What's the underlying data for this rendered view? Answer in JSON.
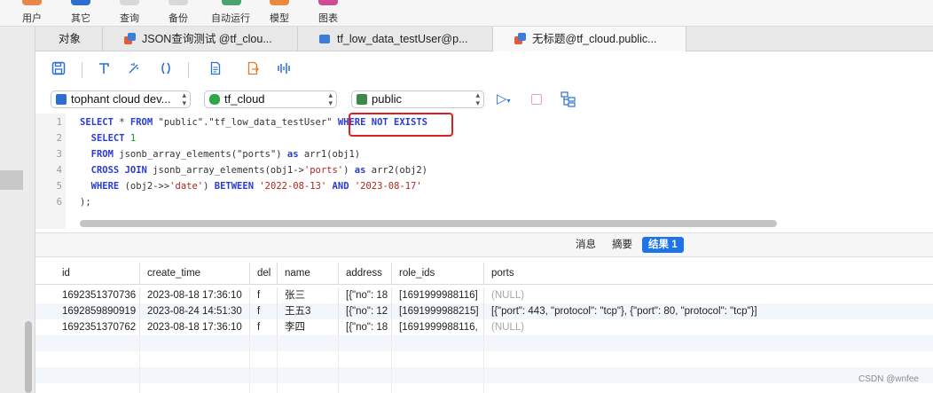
{
  "toolbar": {
    "items": [
      {
        "label": "用户",
        "color": "#e9874a"
      },
      {
        "label": "其它",
        "color": "#2d6fd0"
      },
      {
        "label": "查询",
        "color": "#d8d8d8"
      },
      {
        "label": "备份",
        "color": "#d8d8d8"
      },
      {
        "label": "自动运行",
        "color": "#4aa36a"
      },
      {
        "label": "模型",
        "color": "#e98a3d"
      },
      {
        "label": "图表",
        "color": "#cc4e92"
      }
    ]
  },
  "tabs": [
    {
      "label": "对象",
      "icon": ""
    },
    {
      "label": "JSON查询测试 @tf_clou...",
      "icon": "query-icon"
    },
    {
      "label": "tf_low_data_testUser@p...",
      "icon": "table-icon"
    },
    {
      "label": "无标题@tf_cloud.public...",
      "icon": "query-icon"
    }
  ],
  "editor_toolbar": {
    "icons": [
      "save-icon",
      "format-icon",
      "magic-icon",
      "brackets-icon",
      "document-icon",
      "export-icon",
      "explain-icon"
    ]
  },
  "connection": {
    "server": "tophant cloud dev...",
    "database": "tf_cloud",
    "schema": "public"
  },
  "editor": {
    "line_numbers": [
      "1",
      "2",
      "3",
      "4",
      "5",
      "6"
    ],
    "lines": [
      [
        {
          "t": "SELECT",
          "c": "kw"
        },
        {
          "t": " * ",
          "c": ""
        },
        {
          "t": "FROM",
          "c": "kw"
        },
        {
          "t": " \"public\".\"tf_low_data_testUser\" ",
          "c": ""
        },
        {
          "t": "WHERE NOT EXISTS",
          "c": "kw"
        }
      ],
      [
        {
          "t": "  SELECT",
          "c": "kw"
        },
        {
          "t": " ",
          "c": ""
        },
        {
          "t": "1",
          "c": "num"
        }
      ],
      [
        {
          "t": "  FROM",
          "c": "kw"
        },
        {
          "t": " jsonb_array_elements(\"ports\") ",
          "c": ""
        },
        {
          "t": "as",
          "c": "kw"
        },
        {
          "t": " arr1(obj1)",
          "c": ""
        }
      ],
      [
        {
          "t": "  CROSS JOIN",
          "c": "kw"
        },
        {
          "t": " jsonb_array_elements(obj1->",
          "c": ""
        },
        {
          "t": "'ports'",
          "c": "str"
        },
        {
          "t": ") ",
          "c": ""
        },
        {
          "t": "as",
          "c": "kw"
        },
        {
          "t": " arr2(obj2)",
          "c": ""
        }
      ],
      [
        {
          "t": "  WHERE",
          "c": "kw"
        },
        {
          "t": " (obj2->>",
          "c": ""
        },
        {
          "t": "'date'",
          "c": "str"
        },
        {
          "t": ") ",
          "c": ""
        },
        {
          "t": "BETWEEN",
          "c": "kw"
        },
        {
          "t": " ",
          "c": ""
        },
        {
          "t": "'2022-08-13'",
          "c": "str"
        },
        {
          "t": " ",
          "c": ""
        },
        {
          "t": "AND",
          "c": "kw"
        },
        {
          "t": " ",
          "c": ""
        },
        {
          "t": "'2023-08-17'",
          "c": "str"
        }
      ],
      [
        {
          "t": ");",
          "c": ""
        }
      ]
    ]
  },
  "result_tabs": [
    {
      "label": "消息",
      "active": false
    },
    {
      "label": "摘要",
      "active": false
    },
    {
      "label": "结果 1",
      "active": true
    }
  ],
  "grid": {
    "columns": [
      "id",
      "create_time",
      "del",
      "name",
      "address",
      "role_ids",
      "ports"
    ],
    "rows": [
      [
        "1692351370736",
        "2023-08-18 17:36:10",
        "f",
        "张三",
        "[{\"no\": 18",
        "[1691999988116]",
        "(NULL)"
      ],
      [
        "1692859890919",
        "2023-08-24 14:51:30",
        "f",
        "王五3",
        "[{\"no\": 12",
        "[1691999988215]",
        "[{\"port\": 443, \"protocol\": \"tcp\"}, {\"port\": 80, \"protocol\": \"tcp\"}]"
      ],
      [
        "1692351370762",
        "2023-08-18 17:36:10",
        "f",
        "李四",
        "[{\"no\": 18",
        "[1691999988116,",
        "(NULL)"
      ]
    ]
  },
  "watermark": "CSDN @wnfee"
}
